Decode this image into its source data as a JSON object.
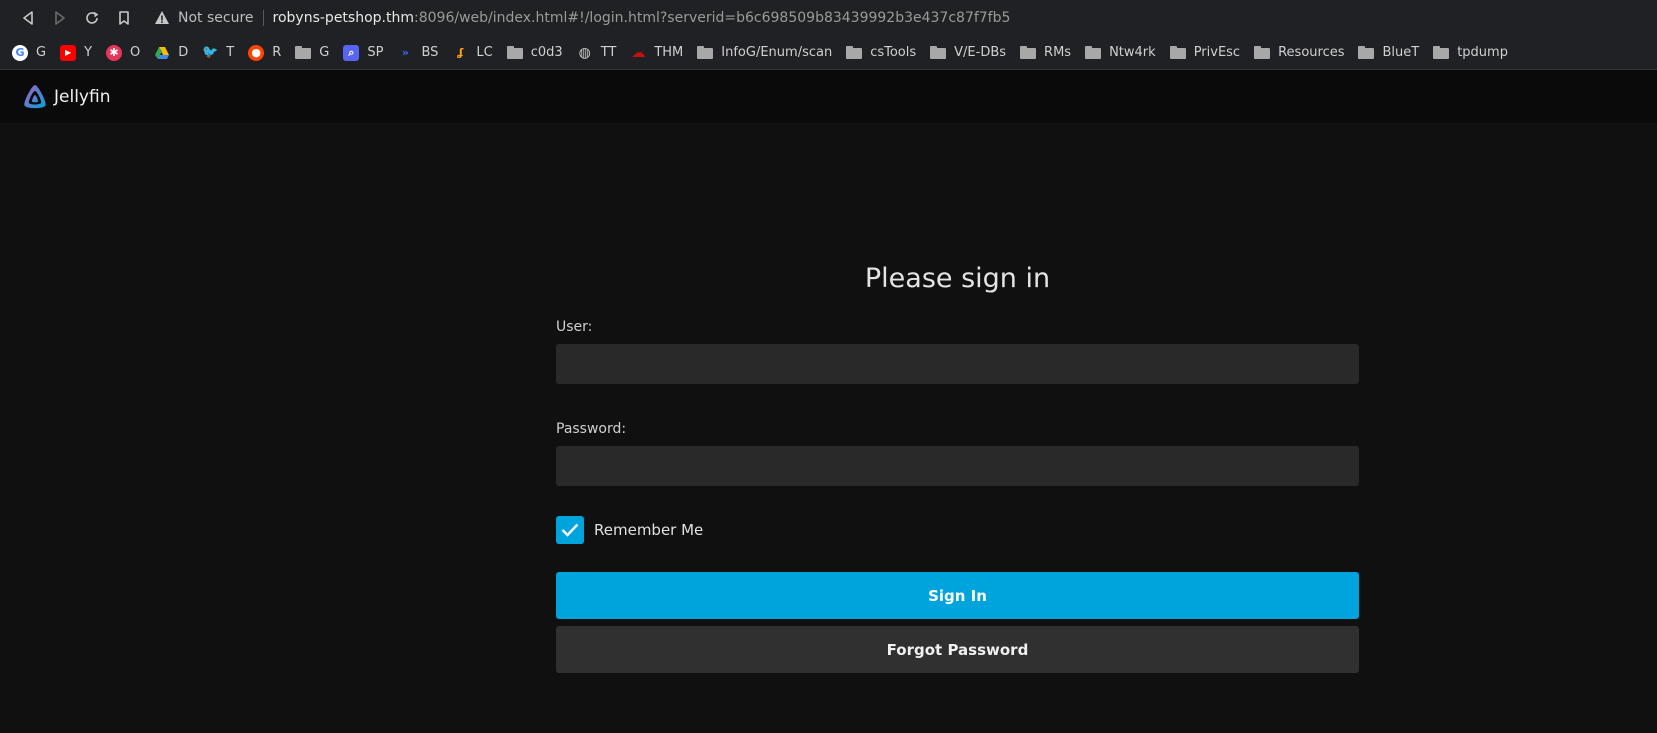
{
  "browser": {
    "security_label": "Not secure",
    "url_host": "robyns-petshop.thm",
    "url_rest": ":8096/web/index.html#!/login.html?serverid=b6c698509b83439992b3e437c87f7fb5"
  },
  "bookmarks": [
    {
      "label": "G",
      "icon": "google-icon"
    },
    {
      "label": "Y",
      "icon": "youtube-icon"
    },
    {
      "label": "O",
      "icon": "octo-icon"
    },
    {
      "label": "D",
      "icon": "drive-icon"
    },
    {
      "label": "T",
      "icon": "twitter-icon"
    },
    {
      "label": "R",
      "icon": "reddit-icon"
    },
    {
      "label": "G",
      "icon": "folder-icon"
    },
    {
      "label": "SP",
      "icon": "search-icon"
    },
    {
      "label": "BS",
      "icon": "bs-icon"
    },
    {
      "label": "LC",
      "icon": "leetcode-icon"
    },
    {
      "label": "c0d3",
      "icon": "folder-icon"
    },
    {
      "label": "TT",
      "icon": "globe-icon"
    },
    {
      "label": "THM",
      "icon": "thm-icon"
    },
    {
      "label": "InfoG/Enum/scan",
      "icon": "folder-icon"
    },
    {
      "label": "csTools",
      "icon": "folder-icon"
    },
    {
      "label": "V/E-DBs",
      "icon": "folder-icon"
    },
    {
      "label": "RMs",
      "icon": "folder-icon"
    },
    {
      "label": "Ntw4rk",
      "icon": "folder-icon"
    },
    {
      "label": "PrivEsc",
      "icon": "folder-icon"
    },
    {
      "label": "Resources",
      "icon": "folder-icon"
    },
    {
      "label": "BlueT",
      "icon": "folder-icon"
    },
    {
      "label": "tpdump",
      "icon": "folder-icon"
    }
  ],
  "app": {
    "name": "Jellyfin"
  },
  "login": {
    "title": "Please sign in",
    "user_label": "User:",
    "user_value": "",
    "password_label": "Password:",
    "password_value": "",
    "remember_label": "Remember Me",
    "remember_checked": true,
    "sign_in_label": "Sign In",
    "forgot_label": "Forgot Password"
  },
  "colors": {
    "accent": "#00a4dc",
    "background": "#101010",
    "field": "#292929",
    "secondary_button": "#303030"
  }
}
